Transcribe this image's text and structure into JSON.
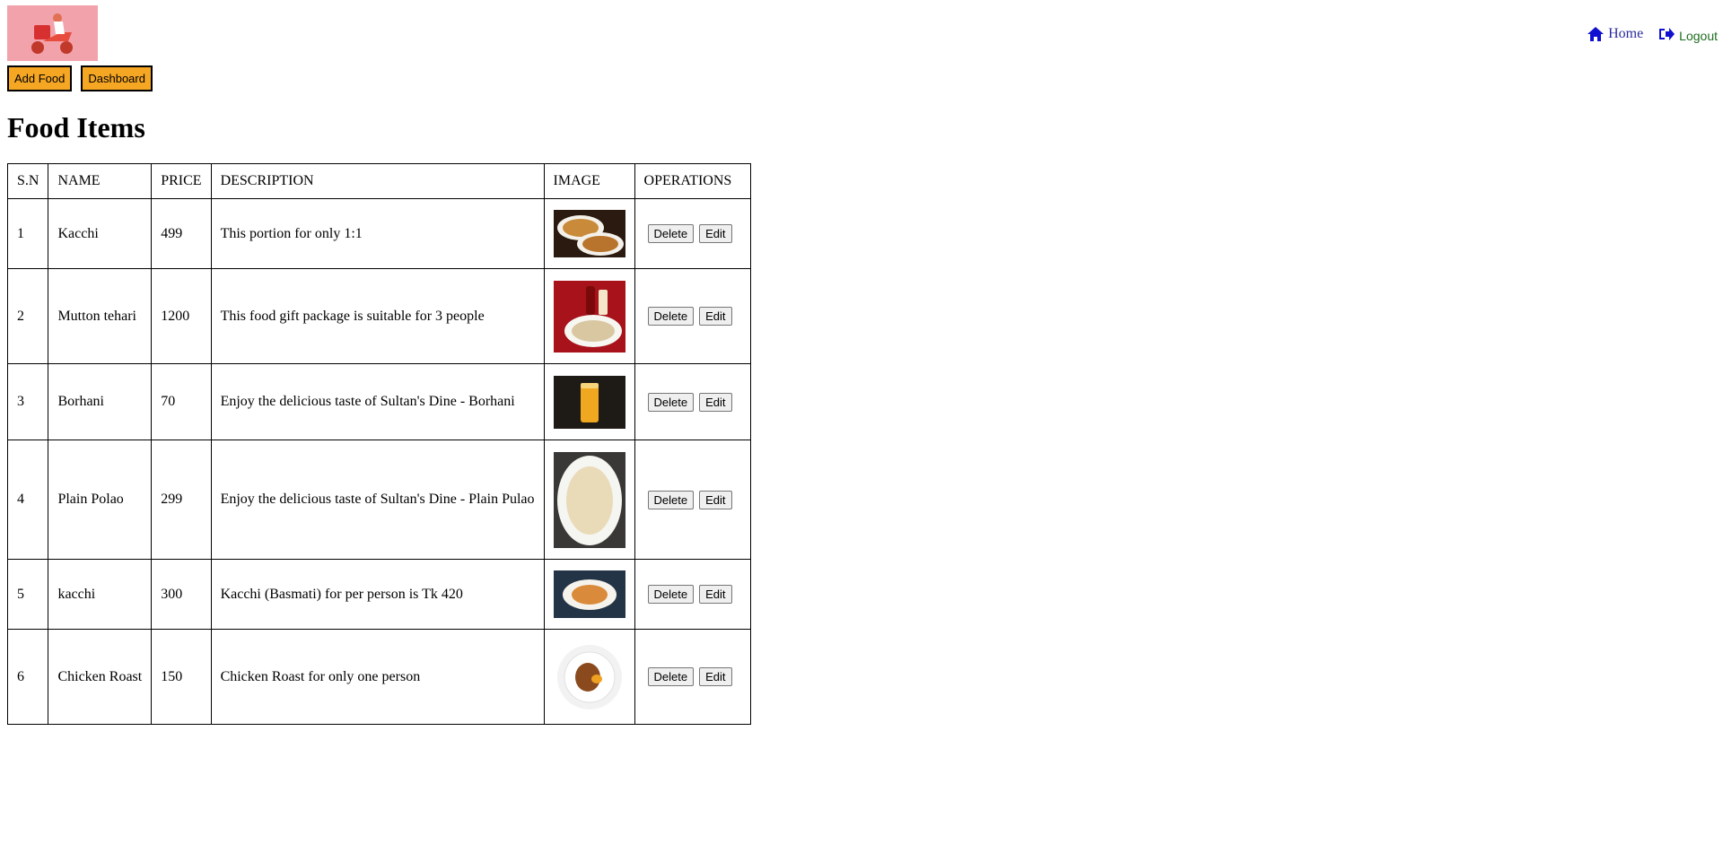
{
  "nav": {
    "home_label": "Home",
    "logout_label": "Logout",
    "home_color": "#2a2aa0",
    "logout_color": "#1f6d1f"
  },
  "actions": {
    "add_food_label": "Add Food",
    "dashboard_label": "Dashboard",
    "button_color": "#f5a623"
  },
  "page": {
    "title": "Food Items"
  },
  "table": {
    "headers": [
      "S.N",
      "NAME",
      "PRICE",
      "DESCRIPTION",
      "IMAGE",
      "OPERATIONS"
    ],
    "rows": [
      {
        "sn": "1",
        "name": "Kacchi",
        "price": "499",
        "description": "This portion for only 1:1",
        "image": "biryani-platter"
      },
      {
        "sn": "2",
        "name": "Mutton tehari",
        "price": "1200",
        "description": "This food gift package is suitable for 3 people",
        "image": "tehari-package"
      },
      {
        "sn": "3",
        "name": "Borhani",
        "price": "70",
        "description": "Enjoy the delicious taste of Sultan's Dine - Borhani",
        "image": "borhani-glass"
      },
      {
        "sn": "4",
        "name": "Plain Polao",
        "price": "299",
        "description": "Enjoy the delicious taste of Sultan's Dine - Plain Pulao",
        "image": "polao-plate"
      },
      {
        "sn": "5",
        "name": "kacchi",
        "price": "300",
        "description": "Kacchi (Basmati) for per person is Tk 420",
        "image": "kacchi-plate"
      },
      {
        "sn": "6",
        "name": "Chicken Roast",
        "price": "150",
        "description": "Chicken Roast for only one person",
        "image": "chicken-roast-plate"
      }
    ],
    "delete_label": "Delete",
    "edit_label": "Edit"
  }
}
